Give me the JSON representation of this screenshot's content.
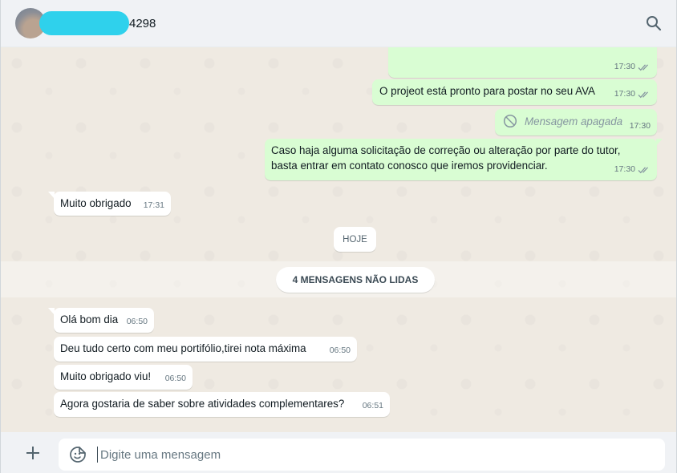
{
  "header": {
    "contact_name": "4298",
    "search_icon": "search-icon"
  },
  "messages_out": [
    {
      "text": "",
      "time": "17:30"
    },
    {
      "text": "O projeot está pronto para postar no seu AVA",
      "time": "17:30"
    },
    {
      "text": "Mensagem apagada",
      "time": "17:30"
    },
    {
      "line1": "Caso haja alguma solicitação de correção ou alteração por parte do tutor,",
      "line2": "basta entrar em contato conosco que iremos providenciar.",
      "time": "17:30"
    }
  ],
  "messages_in_before": [
    {
      "text": "Muito obrigado",
      "time": "17:31"
    }
  ],
  "date_divider": "HOJE",
  "unread_divider": "4 MENSAGENS NÃO LIDAS",
  "messages_in_today": [
    {
      "text": "Olá bom dia",
      "time": "06:50"
    },
    {
      "text": "Deu tudo certo com meu portifólio,tirei nota máxima",
      "time": "06:50"
    },
    {
      "text": "Muito obrigado viu!",
      "time": "06:50"
    },
    {
      "text": "Agora gostaria de saber sobre atividades complementares?",
      "time": "06:51"
    }
  ],
  "composer": {
    "placeholder": "Digite uma mensagem"
  },
  "colors": {
    "outgoing_bubble": "#d9fdd3",
    "incoming_bubble": "#ffffff",
    "chat_background": "#efeae2",
    "redaction": "#2fd1ec"
  }
}
